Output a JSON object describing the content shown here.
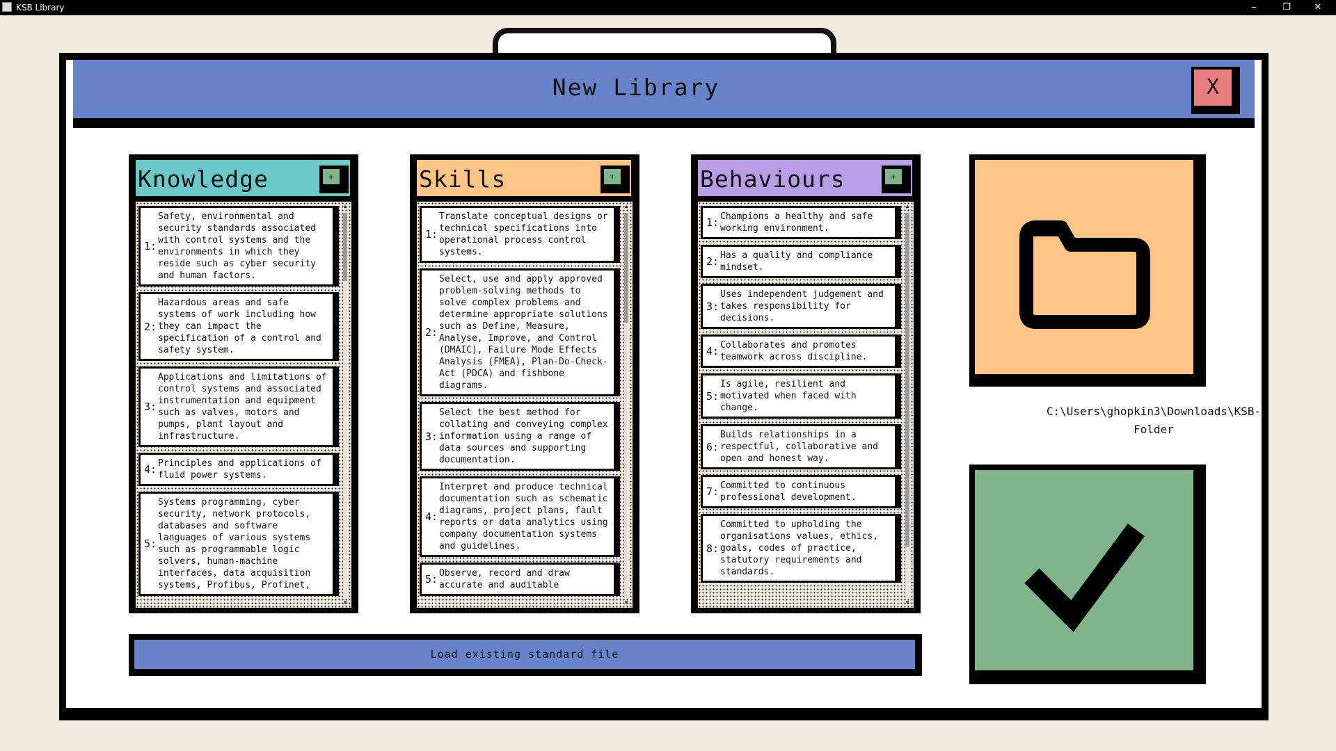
{
  "window": {
    "title": "KSB Library",
    "minimize": "–",
    "maximize": "❐",
    "close": "✕"
  },
  "dialog": {
    "title": "New Library",
    "close_label": "X"
  },
  "columns": {
    "knowledge": {
      "title": "Knowledge",
      "add_label": "+",
      "header_color": "#6cc9c9",
      "items": [
        {
          "num": "1:",
          "text": "Safety, environmental and\nsecurity standards associated\nwith control systems and the\nenvironments in which they\nreside such as cyber security\nand human factors."
        },
        {
          "num": "2:",
          "text": "Hazardous areas and safe\nsystems of work including how\nthey can impact the\nspecification of a control and\nsafety system."
        },
        {
          "num": "3:",
          "text": "Applications and limitations of\ncontrol systems and associated\ninstrumentation and equipment\nsuch as valves, motors and\npumps, plant layout and\ninfrastructure."
        },
        {
          "num": "4:",
          "text": "Principles and applications of\nfluid power systems."
        },
        {
          "num": "5:",
          "text": "Systems programming, cyber\nsecurity, network protocols,\ndatabases and software\nlanguages of various systems\nsuch as programmable logic\nsolvers, human-machine\ninterfaces, data acquisition\nsystems, Profibus, Profinet,"
        }
      ]
    },
    "skills": {
      "title": "Skills",
      "add_label": "+",
      "header_color": "#ffc587",
      "items": [
        {
          "num": "1:",
          "text": "Translate conceptual designs or\ntechnical specifications into\noperational process control\nsystems."
        },
        {
          "num": "2:",
          "text": "Select, use and apply approved\nproblem-solving methods to\nsolve complex problems and\ndetermine appropriate solutions\nsuch as Define, Measure,\nAnalyse, Improve, and Control\n(DMAIC), Failure Mode Effects\nAnalysis (FMEA), Plan-Do-Check-\nAct (PDCA) and fishbone\ndiagrams."
        },
        {
          "num": "3:",
          "text": "Select the best method for\ncollating and conveying complex\ninformation using a range of\ndata sources and supporting\ndocumentation."
        },
        {
          "num": "4:",
          "text": "Interpret and produce technical\ndocumentation such as schematic\ndiagrams, project plans, fault\nreports or data analytics using\ncompany documentation systems\nand guidelines."
        },
        {
          "num": "5:",
          "text": "Observe, record and draw\naccurate and auditable"
        }
      ]
    },
    "behaviours": {
      "title": "Behaviours",
      "add_label": "+",
      "header_color": "#b79ee6",
      "items": [
        {
          "num": "1:",
          "text": "Champions a healthy and safe\nworking environment."
        },
        {
          "num": "2:",
          "text": "Has a quality and compliance\nmindset."
        },
        {
          "num": "3:",
          "text": "Uses independent judgement and\ntakes responsibility for\ndecisions."
        },
        {
          "num": "4:",
          "text": "Collaborates and promotes\nteamwork across discipline."
        },
        {
          "num": "5:",
          "text": "Is agile, resilient and\nmotivated when faced with\nchange."
        },
        {
          "num": "6:",
          "text": "Builds relationships in a\nrespectful, collaborative and\nopen and honest way."
        },
        {
          "num": "7:",
          "text": "Committed to continuous\nprofessional development."
        },
        {
          "num": "8:",
          "text": "Committed to upholding the\norganisations values, ethics,\ngoals, codes of practice,\nstatutory requirements and\nstandards."
        }
      ]
    }
  },
  "folder": {
    "icon": "folder-icon",
    "path": "C:\\Users\\ghopkin3\\Downloads\\KSB-\nFolder"
  },
  "confirm": {
    "icon": "checkmark-icon"
  },
  "load_button": {
    "label": "Load existing standard file"
  },
  "scroll": {
    "up_arrow": "▲",
    "down_arrow": "▼"
  }
}
